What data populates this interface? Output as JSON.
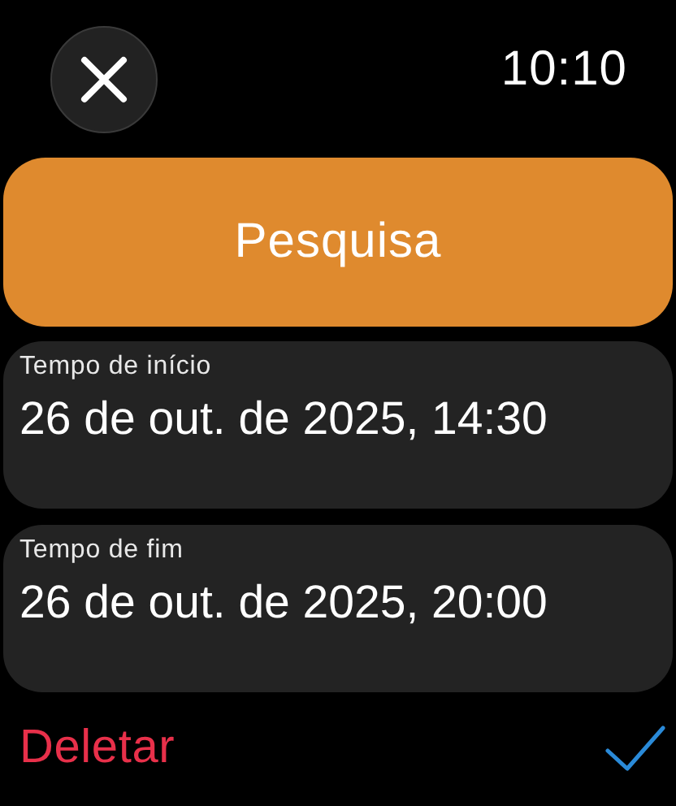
{
  "status_bar": {
    "time": "10:10"
  },
  "search_button": {
    "label": "Pesquisa"
  },
  "fields": [
    {
      "label": "Tempo de início",
      "value": "26 de out. de 2025, 14:30"
    },
    {
      "label": "Tempo de fim",
      "value": "26 de out. de 2025, 20:00"
    }
  ],
  "delete_button": {
    "label": "Deletar"
  }
}
